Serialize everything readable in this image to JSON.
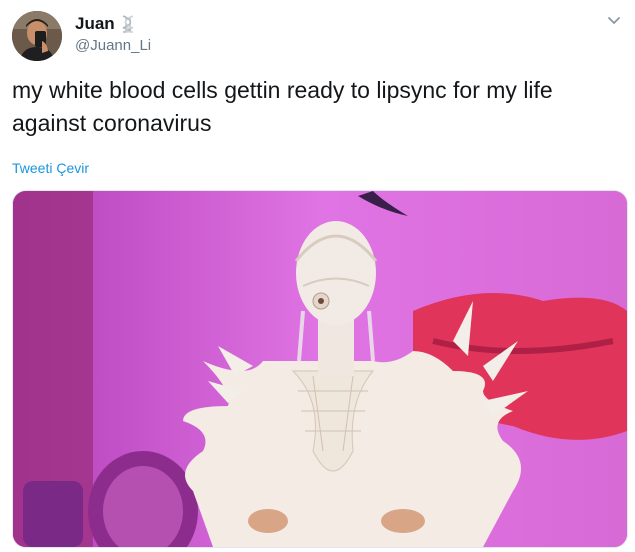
{
  "user": {
    "display_name": "Juan",
    "handle": "@Juann_Li",
    "name_emoji": "dna-icon"
  },
  "tweet": {
    "text": "my white blood cells gettin ready to lipsync for my life\nagainst coronavirus",
    "translate_label": "Tweeti Çevir"
  },
  "media": {
    "description_icon": "photo",
    "palette": {
      "background": "#d45fd8",
      "accent_red": "#e0345a",
      "costume": "#f3ebe4"
    }
  },
  "colors": {
    "text": "#14171a",
    "secondary": "#657786",
    "link": "#1b95e0"
  }
}
